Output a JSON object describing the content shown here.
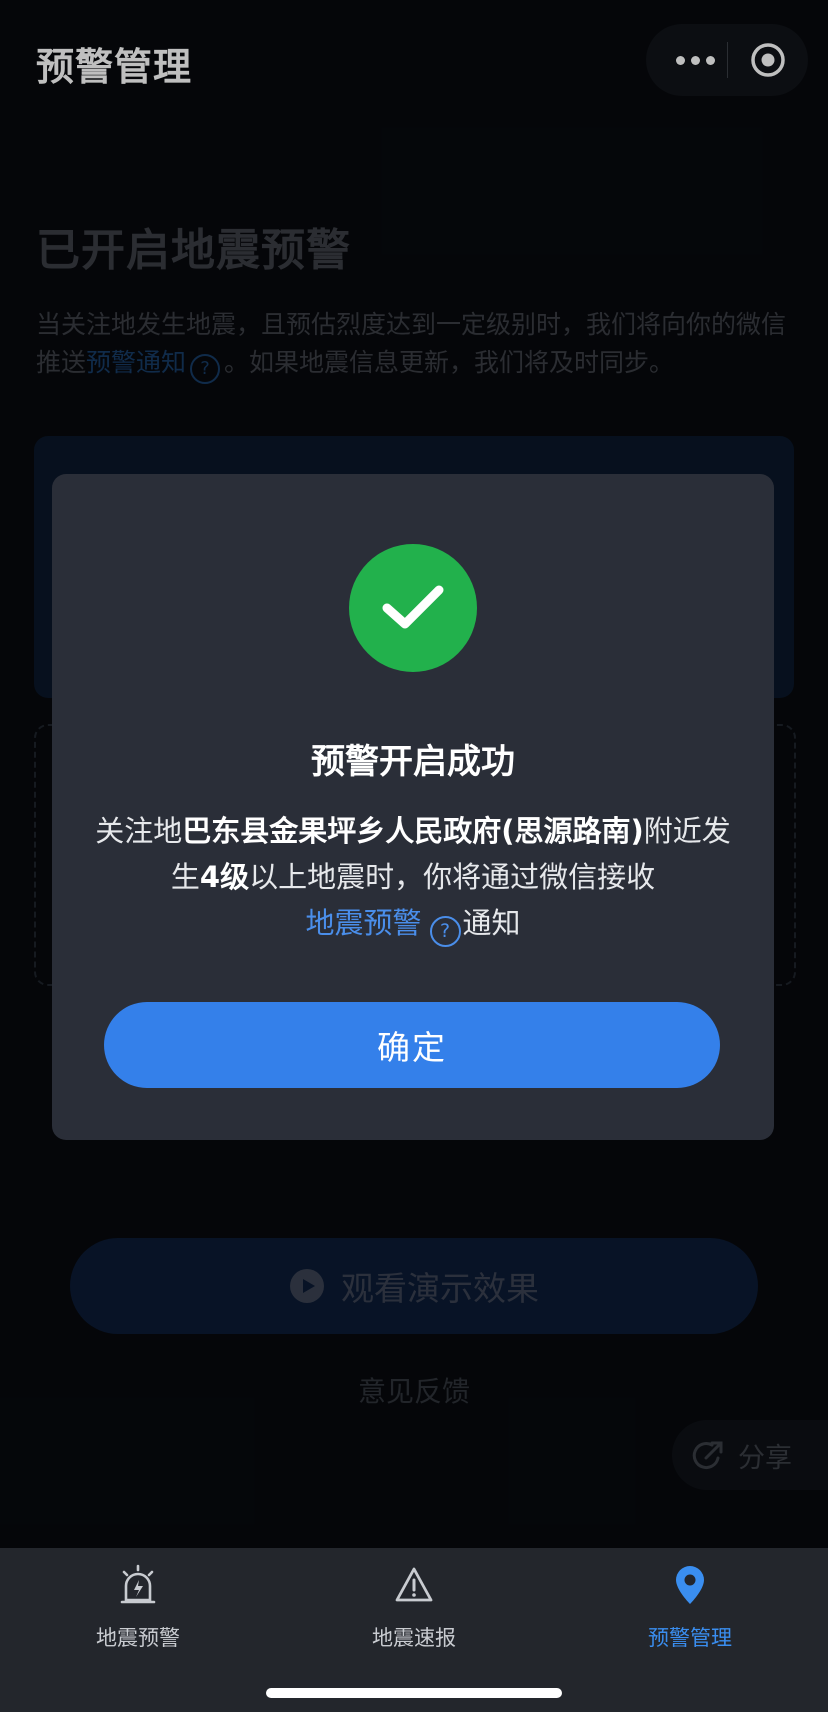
{
  "header": {
    "title": "预警管理",
    "more_icon": "more-dots-icon",
    "target_icon": "target-icon"
  },
  "background": {
    "title": "已开启地震预警",
    "desc_part1": "当关注地发生地震，且预估烈度达到一定级别时，我们将向你的微信推送",
    "desc_link": "预警通知",
    "desc_part2": "。如果地震信息更新，我们将及时同步。",
    "demo_button": "观看演示效果",
    "feedback": "意见反馈",
    "share": "分享"
  },
  "modal": {
    "icon": "check-circle-icon",
    "title": "预警开启成功",
    "body_prefix": "关注地",
    "location": "巴东县金果坪乡人民政府(思源路南)",
    "body_mid1": "附近发生",
    "level": "4级",
    "body_mid2": "以上地震时，你将通过微信接收",
    "link": "地震预警",
    "body_suffix": "通知",
    "confirm": "确定",
    "accent": "#3480ea",
    "success_color": "#22b14c"
  },
  "tabs": [
    {
      "label": "地震预警",
      "icon": "siren-icon",
      "active": false
    },
    {
      "label": "地震速报",
      "icon": "warning-triangle-icon",
      "active": false
    },
    {
      "label": "预警管理",
      "icon": "location-pin-icon",
      "active": true
    }
  ],
  "colors": {
    "active_tab": "#3a8ef0",
    "background": "#07090d"
  }
}
